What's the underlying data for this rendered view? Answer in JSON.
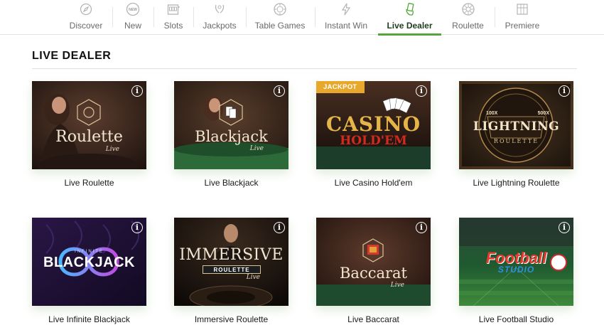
{
  "nav": {
    "items": [
      {
        "label": "Discover",
        "icon": "compass-icon"
      },
      {
        "label": "New",
        "icon": "new-badge-icon",
        "badge": "NEW"
      },
      {
        "label": "Slots",
        "icon": "slot-machine-icon"
      },
      {
        "label": "Jackpots",
        "icon": "laurel-icon"
      },
      {
        "label": "Table Games",
        "icon": "chip-icon"
      },
      {
        "label": "Instant Win",
        "icon": "lightning-icon"
      },
      {
        "label": "Live Dealer",
        "icon": "dealer-hand-icon"
      },
      {
        "label": "Roulette",
        "icon": "roulette-wheel-icon"
      },
      {
        "label": "Premiere",
        "icon": "premiere-icon"
      }
    ],
    "active": "Live Dealer"
  },
  "section": {
    "title": "LIVE DEALER"
  },
  "tiles": [
    {
      "name": "Live Roulette",
      "logo": "Roulette",
      "sub": "Live"
    },
    {
      "name": "Live Blackjack",
      "logo": "Blackjack",
      "sub": "Live"
    },
    {
      "name": "Live Casino Hold'em",
      "logo": "CASINO",
      "logo2": "HOLD'EM",
      "badge": "JACKPOT"
    },
    {
      "name": "Live Lightning Roulette",
      "logo": "LIGHTNING",
      "logo2": "ROULETTE",
      "badge_left": "100X",
      "badge_right": "500X"
    },
    {
      "name": "Live Infinite Blackjack",
      "logo": "BLACKJACK",
      "pre": "INFINITE"
    },
    {
      "name": "Immersive Roulette",
      "logo": "IMMERSIVE",
      "logo2": "ROULETTE",
      "sub": "Live"
    },
    {
      "name": "Live Baccarat",
      "logo": "Baccarat",
      "sub": "Live"
    },
    {
      "name": "Live Football Studio",
      "logo": "Football",
      "logo2": "STUDIO"
    }
  ],
  "info_glyph": "i",
  "colors": {
    "accent": "#55a53a",
    "jackpot": "#e7a82c",
    "title": "#111111"
  }
}
